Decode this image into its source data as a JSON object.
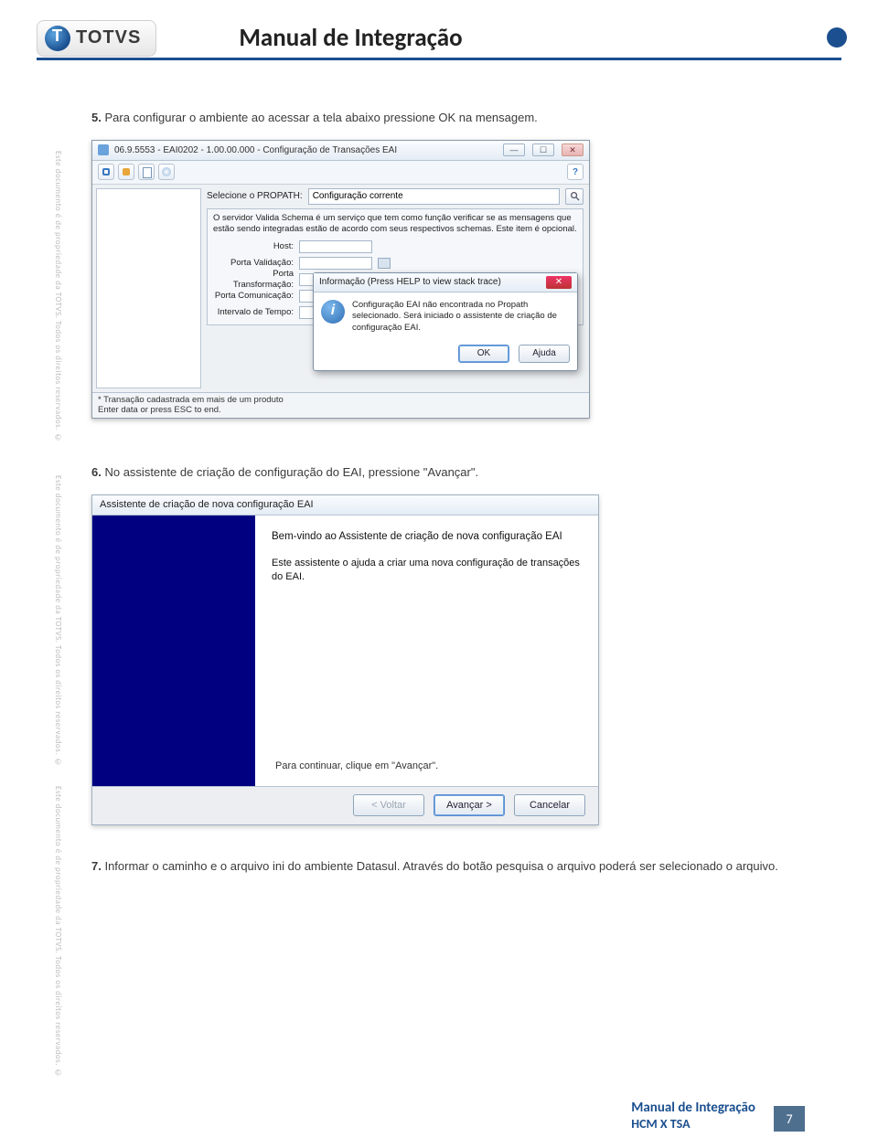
{
  "header": {
    "logo_text": "TOTVS",
    "page_title": "Manual de Integração"
  },
  "copyright": "Este documento é de propriedade da TOTVS. Todos os direitos reservados. ©",
  "step5": {
    "number": "5.",
    "text": "Para configurar o ambiente ao acessar a tela abaixo pressione OK na mensagem."
  },
  "ss1": {
    "window_title": "06.9.5553 - EAI0202 - 1.00.00.000 - Configuração de Transações EAI",
    "win_min": "—",
    "win_max": "☐",
    "win_close": "✕",
    "help_q": "?",
    "search_label": "Selecione o PROPATH:",
    "search_value": "Configuração corrente",
    "desc": "O servidor Valida Schema é um serviço que tem como função verificar se as mensagens que estão sendo integradas estão de acordo com seus respectivos schemas. Este item é opcional.",
    "fields": {
      "host": "Host:",
      "porta_valid": "Porta Validação:",
      "porta_trans": "Porta Transformação:",
      "porta_com": "Porta Comunicação:",
      "intervalo": "Intervalo de Tempo:"
    },
    "overlay": {
      "title": "Informação (Press HELP to view stack trace)",
      "msg": "Configuração EAI não encontrada no Propath selecionado. Será iniciado o assistente de criação de configuração EAI.",
      "ok": "OK",
      "ajuda": "Ajuda",
      "close_x": "✕"
    },
    "status_line1": "* Transação cadastrada em mais de um produto",
    "status_line2": "Enter data or press ESC to end."
  },
  "step6": {
    "number": "6.",
    "text": "No assistente de criação de configuração do EAI, pressione \"Avançar\"."
  },
  "ss2": {
    "title": "Assistente de criação de nova configuração EAI",
    "welcome": "Bem-vindo ao Assistente de criação de nova configuração EAI",
    "body": "Este assistente o ajuda a criar uma nova configuração de transações do EAI.",
    "continue": "Para continuar, clique em \"Avançar\".",
    "btn_back": "< Voltar",
    "btn_next": "Avançar >",
    "btn_cancel": "Cancelar"
  },
  "step7": {
    "number": "7.",
    "text": "Informar o caminho e o arquivo ini do ambiente Datasul. Através do botão pesquisa o arquivo poderá ser selecionado o arquivo."
  },
  "footer": {
    "title": "Manual de Integração",
    "sub": "HCM X TSA",
    "page_number": "7"
  }
}
